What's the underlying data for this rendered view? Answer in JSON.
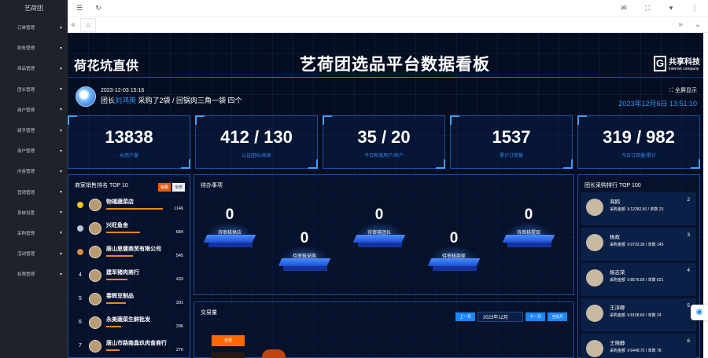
{
  "sidebar": {
    "logo": "艺荷团",
    "items": [
      {
        "label": "订单管理"
      },
      {
        "label": "财务管理"
      },
      {
        "label": "商品管理"
      },
      {
        "label": "团长管理"
      },
      {
        "label": "商户管理"
      },
      {
        "label": "骑手管理"
      },
      {
        "label": "用户管理"
      },
      {
        "label": "内容管理"
      },
      {
        "label": "营销管理"
      },
      {
        "label": "系统设置"
      },
      {
        "label": "采购管理"
      },
      {
        "label": "活动管理"
      },
      {
        "label": "权限管理"
      }
    ]
  },
  "topbar": {
    "menu_icon": "menu-icon",
    "refresh_icon": "refresh-icon"
  },
  "dashboard": {
    "left_title": "荷花坑直供",
    "main_title": "艺荷团选品平台数据看板",
    "brand": {
      "logo_letter": "G",
      "name": "共享科技",
      "sub": "internet company"
    },
    "broadcast": {
      "time": "2023-12-03 15:16",
      "prefix": "团长",
      "leader": "刘鸿英",
      "mid": " 采购了2袋 / ",
      "product": "回锅肉三角一袋 四个"
    },
    "fullscreen_label": "全屏显示",
    "clock": "2023年12月6日 13:51:10",
    "stats": [
      {
        "value": "13838",
        "label": "总用户量"
      },
      {
        "value": "412 / 130",
        "label": "认证团长/商家"
      },
      {
        "value": "35 / 20",
        "label": "今日新增用户/商户"
      },
      {
        "value": "1537",
        "label": "累计订单量"
      },
      {
        "value": "319 / 982",
        "label": "今日订单量/累计"
      }
    ],
    "ranking": {
      "title": "商家销售排名 TOP 10",
      "tab_sales": "销量",
      "tab_all": "全部",
      "rows": [
        {
          "rank": "1",
          "name": "物福蔬菜店",
          "value": 1146,
          "value_label": "1146"
        },
        {
          "rank": "2",
          "name": "兴旺鱼舍",
          "value": 684,
          "value_label": "684"
        },
        {
          "rank": "3",
          "name": "唐山思健商贸有限公司",
          "value": 545,
          "value_label": "545"
        },
        {
          "rank": "4",
          "name": "建军猪肉商行",
          "value": 433,
          "value_label": "433"
        },
        {
          "rank": "5",
          "name": "春辉豆制品",
          "value": 391,
          "value_label": "391"
        },
        {
          "rank": "6",
          "name": "永美蔬菜生鲜批发",
          "value": 296,
          "value_label": "296"
        },
        {
          "rank": "7",
          "name": "唐山市路南晶玖肉食商行",
          "value": 270,
          "value_label": "270"
        }
      ]
    },
    "review": {
      "title": "待办事项",
      "items": [
        {
          "value": "0",
          "label": "待审核供应"
        },
        {
          "value": "0",
          "label": "待审核采购"
        },
        {
          "value": "0",
          "label": "待审核团长"
        },
        {
          "value": "0",
          "label": "待审核商家"
        },
        {
          "value": "0",
          "label": "待审核提现"
        }
      ]
    },
    "trade": {
      "title": "交易量",
      "prev": "上一月",
      "month": "2023年12月",
      "next": "下一月",
      "current": "当前月",
      "legend_all": "全部"
    },
    "buyers": {
      "title": "团长采购排行 TOP 100",
      "rows": [
        {
          "name": "海鸥",
          "rank": "2",
          "stats": "采购金额 ￥12282.50 / 单数 23"
        },
        {
          "name": "杨政",
          "rank": "3",
          "stats": "采购金额 ￥9733.30 / 单数 145"
        },
        {
          "name": "杨志荣",
          "rank": "4",
          "stats": "采购金额 ￥8576.50 / 单数 621"
        },
        {
          "name": "王淳卿",
          "rank": "5",
          "stats": "采购金额 ￥8108.60 / 单数 24"
        },
        {
          "name": "王晓静",
          "rank": "6",
          "stats": "采购金额 ￥6448.70 / 单数 78"
        }
      ]
    }
  }
}
